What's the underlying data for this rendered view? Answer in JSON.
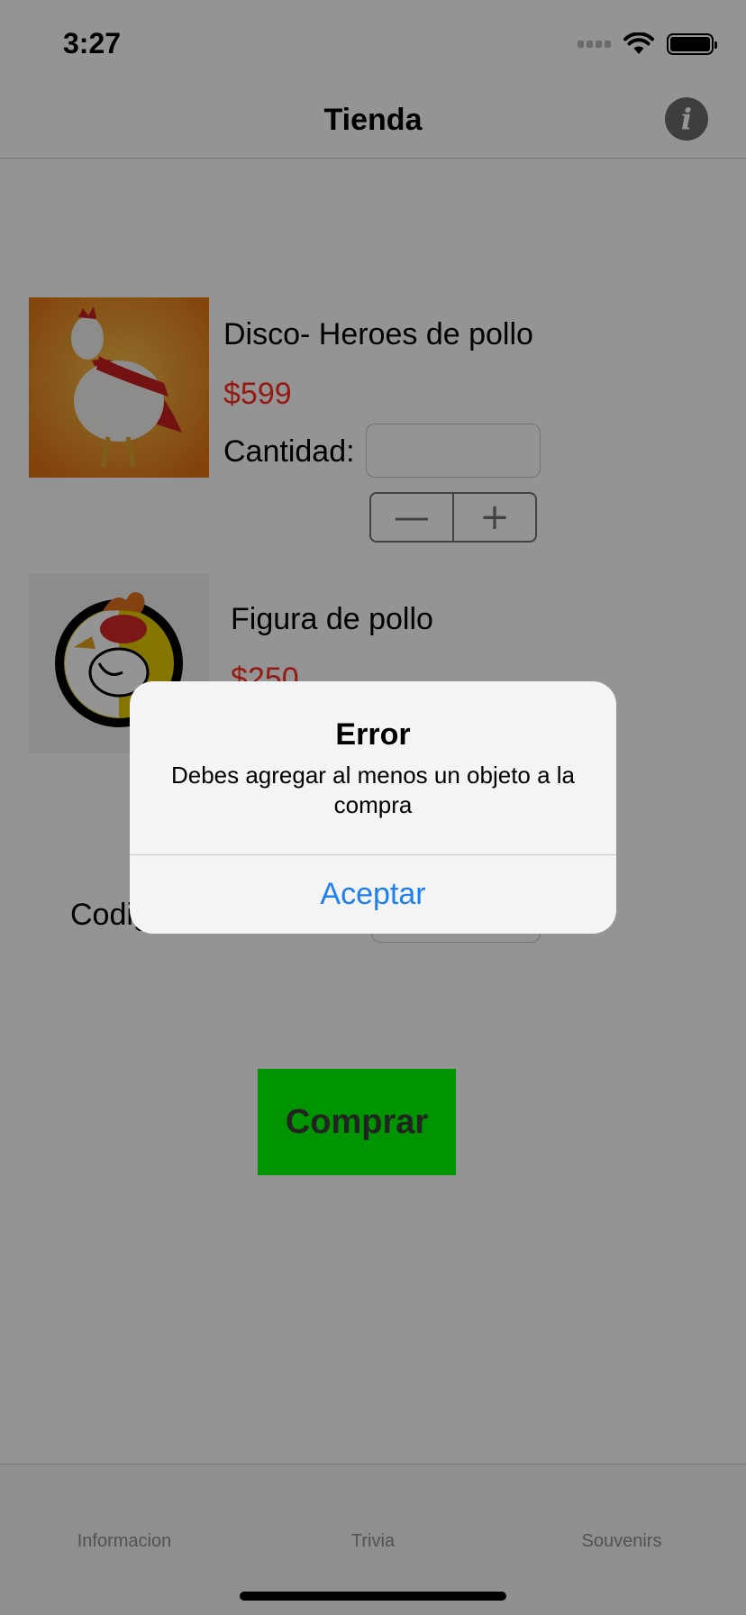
{
  "status_bar": {
    "time": "3:27"
  },
  "nav": {
    "title": "Tienda",
    "info_icon": "i"
  },
  "products": [
    {
      "name": "Disco- Heroes de pollo",
      "price": "$599",
      "quantity_label": "Cantidad:",
      "image": "superhero-chicken-image"
    },
    {
      "name": "Figura de pollo",
      "price": "$250",
      "image": "chicken-logo-image"
    }
  ],
  "stepper": {
    "minus": "—",
    "plus": "+"
  },
  "code": {
    "label": "Codigo"
  },
  "buy_button": {
    "label": "Comprar"
  },
  "tabs": [
    {
      "label": "Informacion"
    },
    {
      "label": "Trivia"
    },
    {
      "label": "Souvenirs"
    }
  ],
  "alert": {
    "title": "Error",
    "message": "Debes agregar al menos un objeto a la compra",
    "action_label": "Aceptar"
  },
  "colors": {
    "price": "#ff2d1f",
    "buy_button": "#00ff00",
    "alert_action": "#1d7ff0",
    "overlay": "rgba(0,0,0,0.42)"
  }
}
